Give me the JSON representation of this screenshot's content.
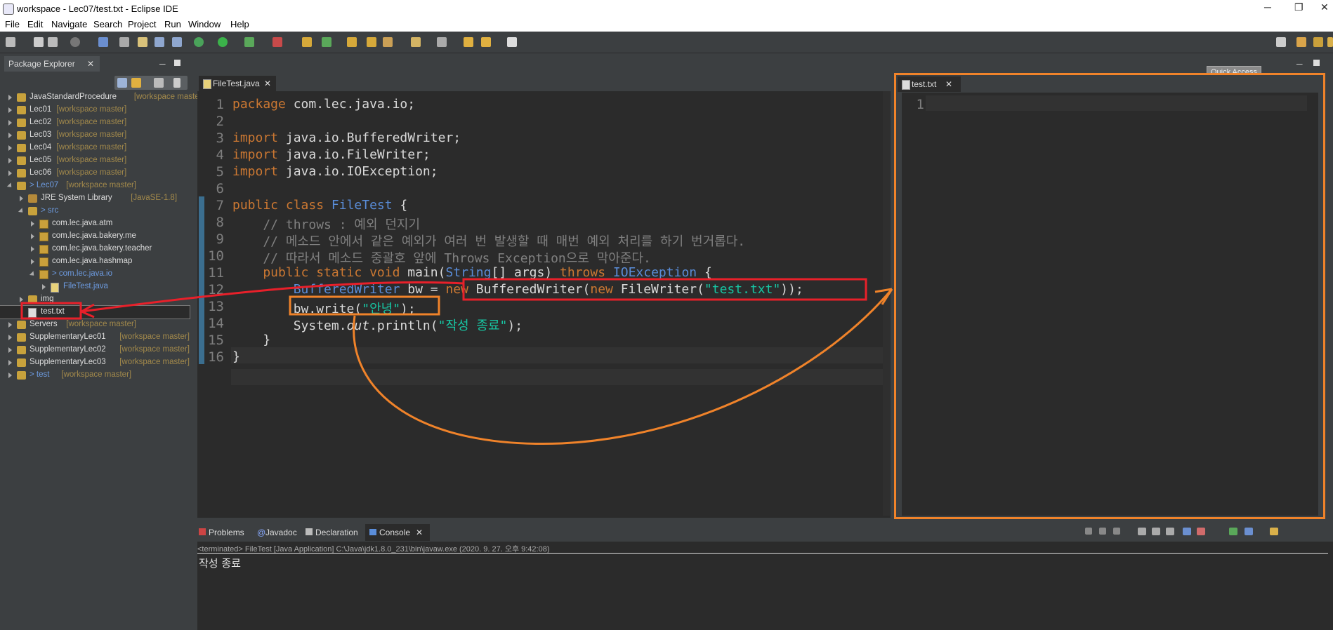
{
  "window": {
    "title": "workspace - Lec07/test.txt - Eclipse IDE"
  },
  "menu": [
    "File",
    "Edit",
    "Navigate",
    "Search",
    "Project",
    "Run",
    "Window",
    "Help"
  ],
  "quick_access": "Quick Access",
  "package_explorer": {
    "tab_label": "Package Explorer",
    "items": [
      {
        "label": "JavaStandardProcedure",
        "decoration": "[workspace maste"
      },
      {
        "label": "Lec01",
        "decoration": "[workspace master]"
      },
      {
        "label": "Lec02",
        "decoration": "[workspace master]"
      },
      {
        "label": "Lec03",
        "decoration": "[workspace master]"
      },
      {
        "label": "Lec04",
        "decoration": "[workspace master]"
      },
      {
        "label": "Lec05",
        "decoration": "[workspace master]"
      },
      {
        "label": "Lec06",
        "decoration": "[workspace master]"
      },
      {
        "label": "> Lec07",
        "decoration": "[workspace master]"
      },
      {
        "label": "JRE System Library",
        "decoration": "[JavaSE-1.8]"
      },
      {
        "label": "> src",
        "decoration": ""
      },
      {
        "label": "com.lec.java.atm",
        "decoration": ""
      },
      {
        "label": "com.lec.java.bakery.me",
        "decoration": ""
      },
      {
        "label": "com.lec.java.bakery.teacher",
        "decoration": ""
      },
      {
        "label": "com.lec.java.hashmap",
        "decoration": ""
      },
      {
        "label": "> com.lec.java.io",
        "decoration": ""
      },
      {
        "label": "FileTest.java",
        "decoration": ""
      },
      {
        "label": "img",
        "decoration": ""
      },
      {
        "label": "test.txt",
        "decoration": ""
      },
      {
        "label": "Servers",
        "decoration": "[workspace master]"
      },
      {
        "label": "SupplementaryLec01",
        "decoration": "[workspace master]"
      },
      {
        "label": "SupplementaryLec02",
        "decoration": "[workspace master]"
      },
      {
        "label": "SupplementaryLec03",
        "decoration": "[workspace master]"
      },
      {
        "label": "> test",
        "decoration": "[workspace master]"
      }
    ]
  },
  "editor_java": {
    "tab_label": "FileTest.java",
    "line_numbers": [
      "1",
      "2",
      "3",
      "4",
      "5",
      "6",
      "7",
      "8",
      "9",
      "10",
      "11",
      "12",
      "13",
      "14",
      "15",
      "16"
    ],
    "code": {
      "l1a": "package",
      "l1b": " com.lec.java.io;",
      "l3a": "import",
      "l3b": " java.io.BufferedWriter;",
      "l4a": "import",
      "l4b": " java.io.FileWriter;",
      "l5a": "import",
      "l5b": " java.io.IOException;",
      "l7a": "public class",
      "l7b": "FileTest",
      "l7c": " {",
      "l8": "    // throws : 예외 던지기",
      "l9": "    // 메소드 안에서 같은 예외가 여러 번 발생할 때 매번 예외 처리를 하기 번거롭다.",
      "l10": "    // 따라서 메소드 중괄호 앞에 Throws Exception으로 막아준다.",
      "l11a": "    public static void",
      "l11b": " main(",
      "l11c": "String",
      "l11d": "[] args) ",
      "l11e": "throws",
      "l11f": "IOException",
      "l11g": " {",
      "l12a": "        BufferedWriter",
      "l12b": " bw = ",
      "l12c": "new",
      "l12d": " BufferedWriter(",
      "l12e": "new",
      "l12f": " FileWriter(",
      "l12g": "\"test.txt\"",
      "l12h": "));",
      "l13a": "        bw.write(",
      "l13b": "\"안녕\"",
      "l13c": ");",
      "l14a": "        System.",
      "l14b": "out",
      "l14c": ".println(",
      "l14d": "\"작성 종료\"",
      "l14e": ");",
      "l15": "    }",
      "l16": "}"
    }
  },
  "editor_txt": {
    "tab_label": "test.txt",
    "line_numbers": [
      "1"
    ]
  },
  "bottom_tabs": [
    "Problems",
    "Javadoc",
    "Declaration",
    "Console"
  ],
  "console": {
    "status": "<terminated> FileTest [Java Application] C:\\Java\\jdk1.8.0_231\\bin\\javaw.exe (2020. 9. 27. 오후 9:42:08)",
    "output": "작성 종료"
  },
  "colors": {
    "annotation_red": "#e8202a",
    "annotation_orange": "#f0832a",
    "editor_bg": "#2b2b2b"
  }
}
